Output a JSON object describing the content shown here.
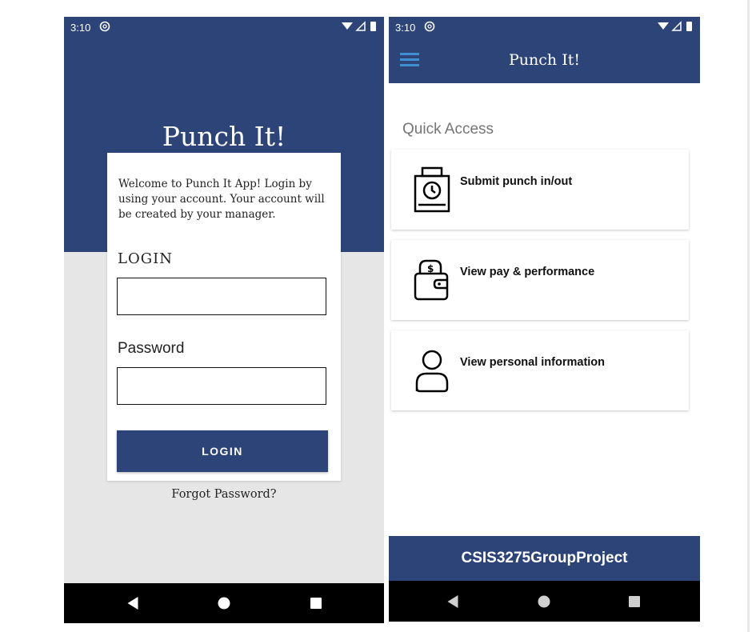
{
  "login_screen": {
    "status": {
      "time": "3:10"
    },
    "title": "Punch It!",
    "welcome_text": "Welcome to Punch It App! Login by using your account. Your account will be created by your manager.",
    "login_label": "LOGIN",
    "login_value": "",
    "password_label": "Password",
    "password_value": "",
    "login_button": "LOGIN",
    "forgot_link": "Forgot Password?"
  },
  "home_screen": {
    "status": {
      "time": "3:10"
    },
    "appbar_title": "Punch It!",
    "section_title": "Quick Access",
    "items": [
      {
        "label": "Submit punch in/out",
        "icon": "punch-clock-icon"
      },
      {
        "label": "View pay & performance",
        "icon": "wallet-icon"
      },
      {
        "label": "View personal information",
        "icon": "person-icon"
      }
    ],
    "footer": "CSIS3275GroupProject"
  },
  "colors": {
    "primary": "#2d4479",
    "background": "#e6e6e6",
    "menu_icon": "#3f8fd0"
  }
}
